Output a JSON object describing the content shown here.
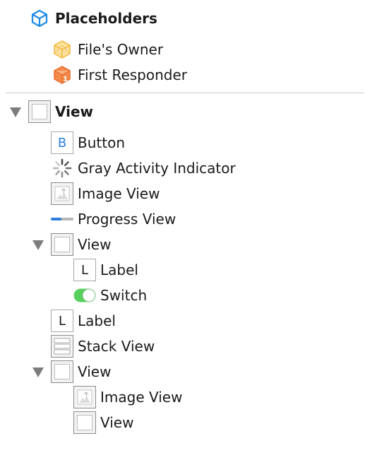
{
  "colors": {
    "placeholder_blue": "#1e8ae6",
    "owner_yellow": "#f6c443",
    "responder_orange": "#f07d3c",
    "switch_green": "#59d05d",
    "button_blue": "#2e7fdc"
  },
  "placeholders": {
    "title": "Placeholders",
    "icon": "cube-outline-icon",
    "items": [
      {
        "label": "File's Owner",
        "icon": "files-owner-cube-icon"
      },
      {
        "label": "First Responder",
        "icon": "first-responder-cube-icon"
      }
    ]
  },
  "tree": {
    "root": {
      "label": "View",
      "icon": "view-icon",
      "expanded": true
    },
    "items": [
      {
        "label": "Button",
        "icon": "button-icon",
        "icon_letter": "B"
      },
      {
        "label": "Gray Activity Indicator",
        "icon": "activity-indicator-icon"
      },
      {
        "label": "Image View",
        "icon": "image-view-icon"
      },
      {
        "label": "Progress View",
        "icon": "progress-view-icon"
      },
      {
        "label": "View",
        "icon": "view-icon",
        "expanded": true
      },
      {
        "label": "Label",
        "icon": "label-icon",
        "icon_letter": "L"
      },
      {
        "label": "Switch",
        "icon": "switch-icon"
      },
      {
        "label": "Label",
        "icon": "label-icon",
        "icon_letter": "L"
      },
      {
        "label": "Stack View",
        "icon": "stack-view-icon"
      },
      {
        "label": "View",
        "icon": "view-icon",
        "expanded": true
      },
      {
        "label": "Image View",
        "icon": "image-view-icon"
      },
      {
        "label": "View",
        "icon": "view-icon"
      }
    ]
  }
}
